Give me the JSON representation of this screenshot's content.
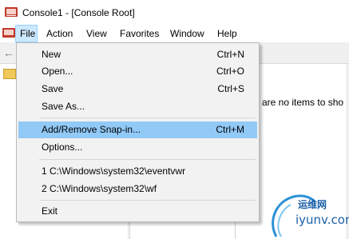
{
  "window": {
    "title": "Console1 - [Console Root]"
  },
  "menubar": [
    {
      "label": "File"
    },
    {
      "label": "Action"
    },
    {
      "label": "View"
    },
    {
      "label": "Favorites"
    },
    {
      "label": "Window"
    },
    {
      "label": "Help"
    }
  ],
  "file_menu": {
    "items": [
      {
        "label": "New",
        "shortcut": "Ctrl+N"
      },
      {
        "label": "Open...",
        "shortcut": "Ctrl+O"
      },
      {
        "label": "Save",
        "shortcut": "Ctrl+S"
      },
      {
        "label": "Save As...",
        "shortcut": ""
      },
      {
        "label": "Add/Remove Snap-in...",
        "shortcut": "Ctrl+M",
        "highlighted": true
      },
      {
        "label": "Options...",
        "shortcut": ""
      },
      {
        "label": "1 C:\\Windows\\system32\\eventvwr",
        "shortcut": ""
      },
      {
        "label": "2 C:\\Windows\\system32\\wf",
        "shortcut": ""
      },
      {
        "label": "Exit",
        "shortcut": ""
      }
    ]
  },
  "main": {
    "empty_message": "e are no items to sho"
  },
  "watermark": {
    "line1": "运维网",
    "line2": "iyunv.com"
  },
  "colors": {
    "highlight": "#91c9f7",
    "menu_active": "#cce8ff",
    "menu_bg": "#f2f2f2",
    "watermark": "#1a5fa8"
  },
  "icons": [
    "console-app-icon",
    "back-arrow-icon",
    "folder-icon",
    "watermark-logo-icon"
  ]
}
